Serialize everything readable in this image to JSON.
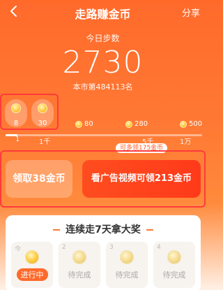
{
  "nav": {
    "title": "走路赚金币",
    "share_label": "分享"
  },
  "summary": {
    "label": "今日步数",
    "steps": "2730",
    "rank_text": "本市第484113名"
  },
  "progress": {
    "fill_fraction": 0.06,
    "coins": [
      {
        "amount": "8",
        "claimable": true
      },
      {
        "amount": "30",
        "claimable": true
      },
      {
        "amount": "80",
        "claimable": false
      },
      {
        "amount": "280",
        "claimable": false
      },
      {
        "amount": "500",
        "claimable": false
      }
    ],
    "ticks": [
      "1",
      "1千",
      "5千",
      "1万"
    ]
  },
  "bonus_pill": "可多领175金币",
  "buttons": {
    "claim": "领取38金币",
    "ad": "看广告视频可领213金币"
  },
  "streak": {
    "title": "连续走7天拿大奖",
    "days": [
      {
        "num": "今",
        "status": "进行中",
        "active": true
      },
      {
        "num": "2",
        "status": "待完成",
        "active": false
      },
      {
        "num": "3",
        "status": "待完成",
        "active": false
      },
      {
        "num": "4",
        "status": "待完成",
        "active": false
      }
    ]
  },
  "colors": {
    "accent": "#ff6a2b",
    "highlight_outline": "#ff3b3b"
  }
}
